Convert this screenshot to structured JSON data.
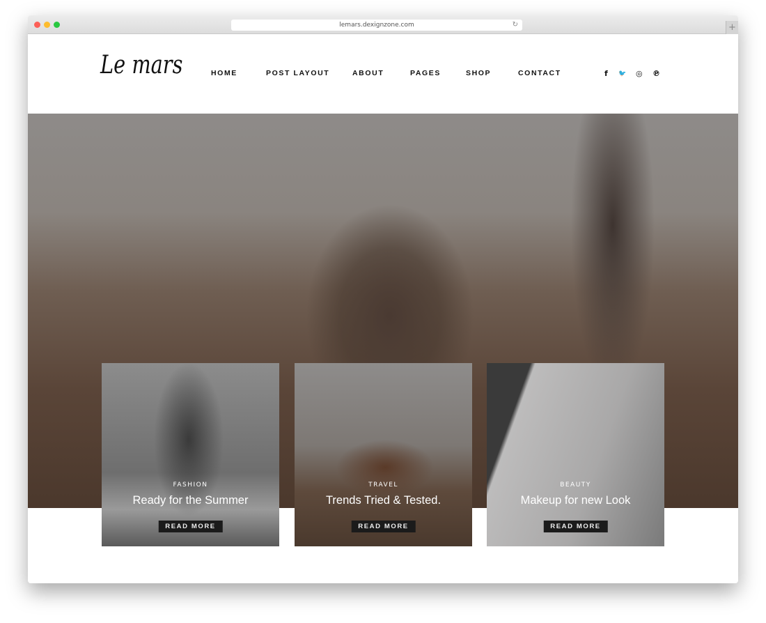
{
  "browser": {
    "url": "lemars.dexignzone.com",
    "new_tab": "+",
    "reload": "↻"
  },
  "logo": "Le mars",
  "nav": [
    "HOME",
    "POST LAYOUT",
    "ABOUT",
    "PAGES",
    "SHOP",
    "CONTACT"
  ],
  "social": [
    {
      "icon": "facebook-icon",
      "glyph": "f"
    },
    {
      "icon": "twitter-icon",
      "glyph": "🐦"
    },
    {
      "icon": "instagram-icon",
      "glyph": "◎"
    },
    {
      "icon": "pinterest-icon",
      "glyph": "℗"
    }
  ],
  "cards": [
    {
      "category": "FASHION",
      "title": "Ready for the Summer",
      "button": "READ MORE"
    },
    {
      "category": "TRAVEL",
      "title": "Trends Tried & Tested.",
      "button": "READ MORE"
    },
    {
      "category": "BEAUTY",
      "title": "Makeup for new Look",
      "button": "READ MORE"
    }
  ]
}
